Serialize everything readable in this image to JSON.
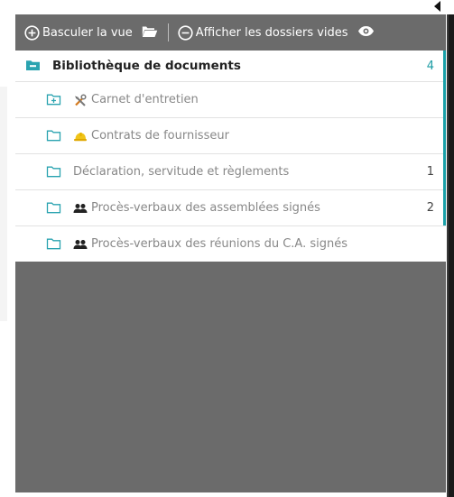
{
  "toolbar": {
    "toggle_view_label": "Basculer la vue",
    "show_empty_label": "Afficher les dossiers vides"
  },
  "library": {
    "title": "Bibliothèque de documents",
    "count": "4",
    "folders": [
      {
        "label": "Carnet d'entretien",
        "count": "",
        "icon": "tools-icon",
        "expandable": true
      },
      {
        "label": "Contrats de fournisseur",
        "count": "",
        "icon": "hard-hat-icon",
        "expandable": false
      },
      {
        "label": "Déclaration, servitude et règlements",
        "count": "1",
        "icon": "",
        "expandable": false
      },
      {
        "label": "Procès-verbaux des assemblées signés",
        "count": "2",
        "icon": "people-icon",
        "expandable": false
      },
      {
        "label": "Procès-verbaux des réunions du C.A. signés",
        "count": "",
        "icon": "people-icon",
        "expandable": false
      }
    ]
  },
  "colors": {
    "panel_bg": "#6b6b6b",
    "accent": "#1aa0a8",
    "folder_icon": "#2aa3b0"
  }
}
